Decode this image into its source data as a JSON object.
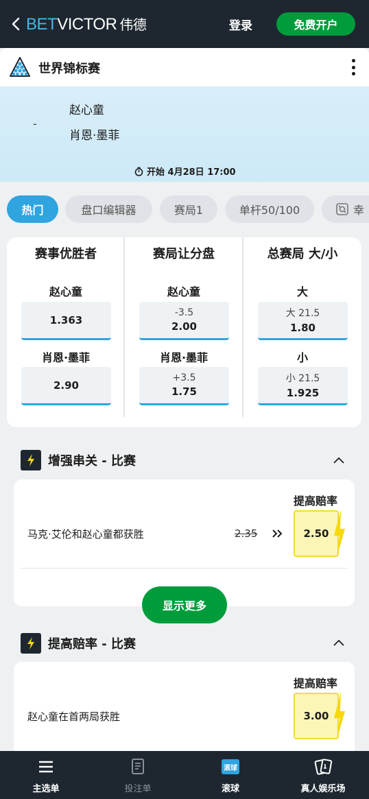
{
  "header": {
    "logo_bet": "BET",
    "logo_victor": "VICTOR",
    "logo_cn": "伟德",
    "login_label": "登录",
    "signup_label": "免费开户"
  },
  "event": {
    "title": "世界锦标赛",
    "dash": "-",
    "player1": "赵心童",
    "player2": "肖恩·墨菲",
    "start_text": "开始 4月28日 17:00"
  },
  "tabs": [
    {
      "label": "热门",
      "active": true
    },
    {
      "label": "盘口编辑器"
    },
    {
      "label": "赛局1"
    },
    {
      "label": "单杆50/100"
    },
    {
      "label": "幸"
    }
  ],
  "markets": [
    {
      "header": "赛事优胜者",
      "selections": [
        {
          "name": "赵心童",
          "line": "",
          "price": "1.363"
        },
        {
          "name": "肖恩·墨菲",
          "line": "",
          "price": "2.90"
        }
      ]
    },
    {
      "header": "赛局让分盘",
      "selections": [
        {
          "name": "赵心童",
          "line": "-3.5",
          "price": "2.00"
        },
        {
          "name": "肖恩·墨菲",
          "line": "+3.5",
          "price": "1.75"
        }
      ]
    },
    {
      "header": "总赛局 大/小",
      "selections": [
        {
          "name": "大",
          "line": "大 21.5",
          "price": "1.80"
        },
        {
          "name": "小",
          "line": "小 21.5",
          "price": "1.925"
        }
      ]
    }
  ],
  "boost_section_1": {
    "title": "增强串关 - 比赛",
    "boost_label": "提高赔率",
    "text": "马克·艾伦和赵心童都获胜",
    "old_odds": "2.35",
    "new_odds": "2.50",
    "show_more": "显示更多"
  },
  "boost_section_2": {
    "title": "提高赔率 - 比赛",
    "boost_label": "提高赔率",
    "text": "赵心童在首两局获胜",
    "new_odds": "3.00"
  },
  "bottom_nav": [
    {
      "label": "主选单",
      "icon": "menu-icon"
    },
    {
      "label": "投注单",
      "icon": "betslip-icon"
    },
    {
      "label": "滚球",
      "icon": "live-icon",
      "badge": "滚球"
    },
    {
      "label": "真人娱乐场",
      "icon": "cards-icon"
    }
  ],
  "colors": {
    "header_bg": "#1e2730",
    "green": "#009c3b",
    "blue": "#2fa4df",
    "boost_yellow": "#fbf6b5"
  }
}
